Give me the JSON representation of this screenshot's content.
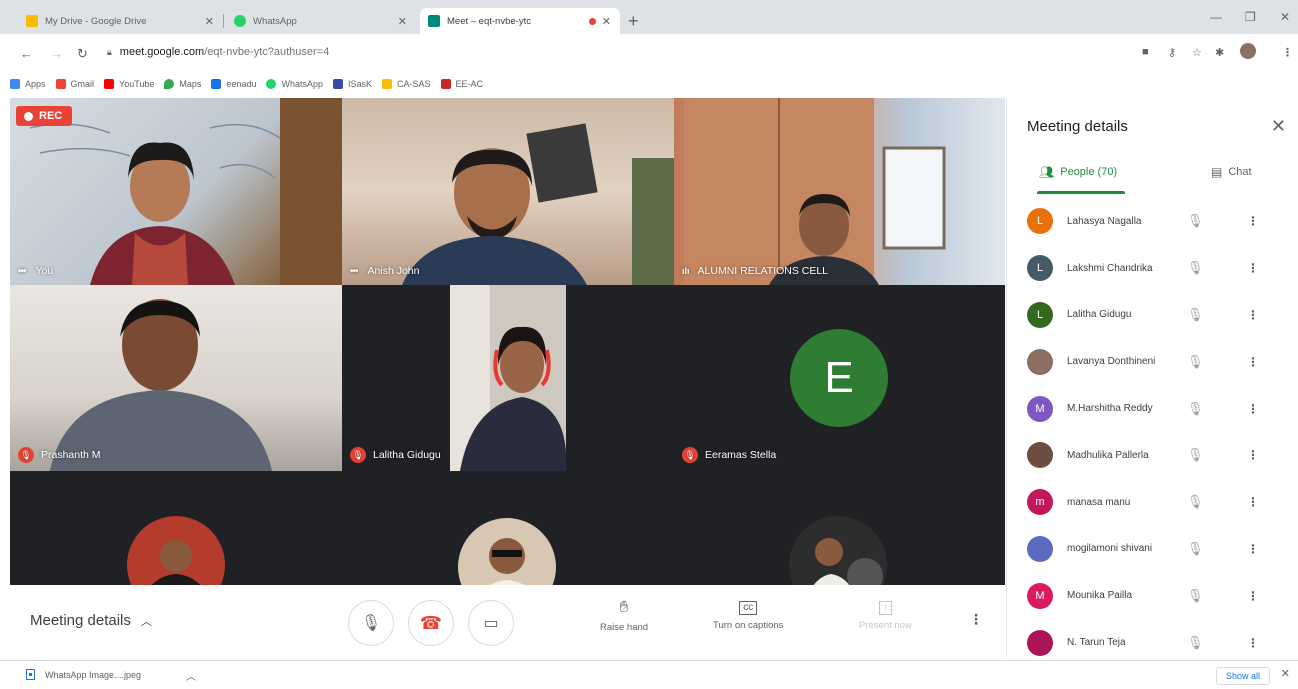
{
  "browser": {
    "tabs": [
      {
        "title": "My Drive - Google Drive",
        "favicon_color": "#fbbc04"
      },
      {
        "title": "WhatsApp",
        "favicon_color": "#25d366"
      },
      {
        "title": "Meet – eqt-nvbe-ytc",
        "favicon_color": "#00897b"
      }
    ],
    "new_tab_icon": "+",
    "url_host": "meet.google.com",
    "url_path": "/eqt-nvbe-ytc?authuser=4",
    "bookmarks": [
      {
        "label": "Apps",
        "color": "#4285f4"
      },
      {
        "label": "Gmail",
        "color": "#ea4335"
      },
      {
        "label": "YouTube",
        "color": "#ff0000"
      },
      {
        "label": "Maps",
        "color": "#34a853"
      },
      {
        "label": "eenadu",
        "color": "#1a73e8"
      },
      {
        "label": "WhatsApp",
        "color": "#25d366"
      },
      {
        "label": "ISasK",
        "color": "#3949ab"
      },
      {
        "label": "CA-SAS",
        "color": "#fbbc04"
      },
      {
        "label": "EE-AC",
        "color": "#c62828"
      }
    ]
  },
  "meet": {
    "rec_label": "REC",
    "tiles": [
      {
        "name": "You"
      },
      {
        "name": "Anish John"
      },
      {
        "name": "ALUMNI RELATIONS CELL"
      },
      {
        "name": "Prashanth M"
      },
      {
        "name": "Lalitha Gidugu"
      },
      {
        "name": "Eeramas Stella",
        "avatar_letter": "E",
        "avatar_color": "#2e7d32"
      }
    ],
    "controls": {
      "meeting_details": "Meeting details",
      "raise_hand": "Raise hand",
      "captions": "Turn on captions",
      "present": "Present now"
    }
  },
  "panel": {
    "title": "Meeting details",
    "tab_people": "People (70)",
    "tab_chat": "Chat",
    "accent": "#1e8e3e",
    "participants": [
      {
        "name": "Lahasya Nagalla",
        "initial": "L",
        "color": "#e8710a"
      },
      {
        "name": "Lakshmi Chandrika",
        "initial": "L",
        "color": "#455a64"
      },
      {
        "name": "Lalitha Gidugu",
        "initial": "L",
        "color": "#33691e"
      },
      {
        "name": "Lavanya Donthineni",
        "initial": "",
        "color": "#8d6e63"
      },
      {
        "name": "M.Harshitha Reddy",
        "initial": "M",
        "color": "#7e57c2"
      },
      {
        "name": "Madhulika Pallerla",
        "initial": "",
        "color": "#6d4c41"
      },
      {
        "name": "manasa manu",
        "initial": "m",
        "color": "#c2185b"
      },
      {
        "name": "mogilamoni shivani",
        "initial": "",
        "color": "#5c6bc0"
      },
      {
        "name": "Mounika Pailla",
        "initial": "M",
        "color": "#d81b60"
      },
      {
        "name": "N. Tarun Teja",
        "initial": "",
        "color": "#ad1457"
      }
    ]
  },
  "downloads": {
    "file": "WhatsApp Image....jpeg",
    "show_all": "Show all"
  }
}
